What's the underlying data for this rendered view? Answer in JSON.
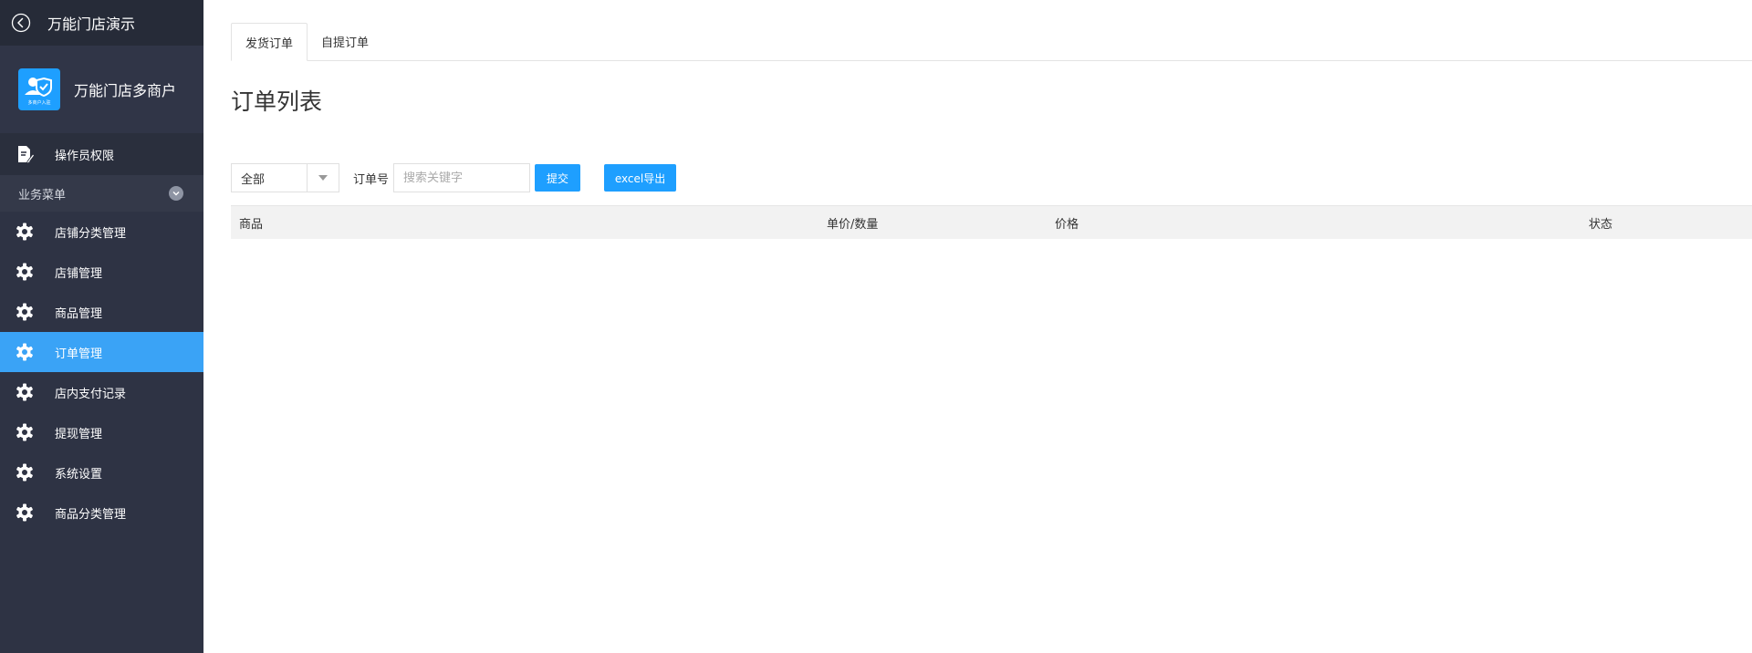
{
  "app": {
    "title": "万能门店演示",
    "merchant_name": "万能门店多商户",
    "logo_caption": "多商户入驻"
  },
  "sidebar": {
    "primary_item": {
      "label": "操作员权限",
      "icon": "document-edit-icon"
    },
    "group": {
      "label": "业务菜单",
      "toggle_icon": "chevron-down-icon"
    },
    "items": [
      {
        "label": "店铺分类管理",
        "icon": "gear-icon",
        "active": false
      },
      {
        "label": "店铺管理",
        "icon": "gear-icon",
        "active": false
      },
      {
        "label": "商品管理",
        "icon": "gear-icon",
        "active": false
      },
      {
        "label": "订单管理",
        "icon": "gear-icon",
        "active": true
      },
      {
        "label": "店内支付记录",
        "icon": "gear-icon",
        "active": false
      },
      {
        "label": "提现管理",
        "icon": "gear-icon",
        "active": false
      },
      {
        "label": "系统设置",
        "icon": "gear-icon",
        "active": false
      },
      {
        "label": "商品分类管理",
        "icon": "gear-icon",
        "active": false
      }
    ]
  },
  "tabs": [
    {
      "label": "发货订单",
      "active": true
    },
    {
      "label": "自提订单",
      "active": false
    }
  ],
  "page": {
    "title": "订单列表"
  },
  "filters": {
    "status_select": {
      "value": "全部"
    },
    "order_no_label": "订单号",
    "search": {
      "placeholder": "搜索关键字",
      "value": ""
    },
    "submit_label": "提交",
    "export_label": "excel导出"
  },
  "table": {
    "headers": [
      "商品",
      "单价/数量",
      "价格",
      "状态"
    ],
    "rows": []
  },
  "colors": {
    "sidebar_bg": "#2e3344",
    "accent": "#1e9fff",
    "active_item": "#3aa3f6"
  }
}
